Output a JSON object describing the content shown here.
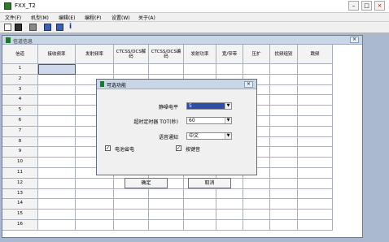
{
  "window": {
    "title": "FXX_T2",
    "min": "–",
    "max": "□",
    "close": "×"
  },
  "menu": [
    "文件(F)",
    "机型(M)",
    "编辑(E)",
    "编程(P)",
    "设置(W)",
    "关于(A)"
  ],
  "toolbar_icons": [
    "new-icon",
    "open-icon",
    "print-icon",
    "read-icon",
    "write-icon",
    "info-icon"
  ],
  "child": {
    "title": "信道信息",
    "close": "×"
  },
  "grid": {
    "headers": [
      "信道",
      "接收频率",
      "发射频率",
      "CTCSS/DCS解码",
      "CTCSS/DCS编码",
      "发射功率",
      "宽/窄带",
      "压扩",
      "扰频组别",
      "跳频"
    ],
    "rows": [
      "1",
      "2",
      "3",
      "4",
      "5",
      "6",
      "7",
      "8",
      "9",
      "10",
      "11",
      "12",
      "13",
      "14",
      "15",
      "16"
    ]
  },
  "dialog": {
    "title": "可选功能",
    "close": "×",
    "squelch": {
      "label": "静噪电平",
      "value": "5"
    },
    "tot": {
      "label": "超时定时器 TOT(秒)",
      "value": "60"
    },
    "voice": {
      "label": "语音通知",
      "value": "中文"
    },
    "battery_save": {
      "label": "电池省电",
      "checked": "✓"
    },
    "beep": {
      "label": "按键音",
      "checked": "✓"
    },
    "ok": "确定",
    "cancel": "取消"
  },
  "colors": {
    "selection": "#2f4fa6",
    "accent_green": "#1a7a2a",
    "mdi_bg": "#aab9ce"
  }
}
